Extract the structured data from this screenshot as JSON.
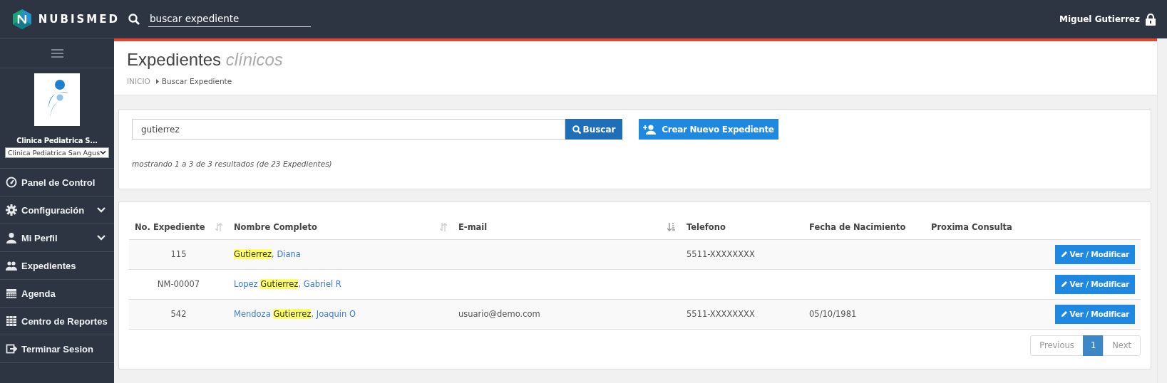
{
  "topbar": {
    "brand": "NUBISMED",
    "search": {
      "placeholder": "buscar expediente"
    },
    "user": "Miguel Gutierrez"
  },
  "sidebar": {
    "clinic_name": "Clinica Pediatrica S...",
    "clinic_select": "Clinica Pediatrica San Agus",
    "items": [
      {
        "label": "Panel de Control",
        "expandable": false
      },
      {
        "label": "Configuración",
        "expandable": true
      },
      {
        "label": "Mi Perfil",
        "expandable": true
      },
      {
        "label": "Expedientes",
        "expandable": false
      },
      {
        "label": "Agenda",
        "expandable": false
      },
      {
        "label": "Centro de Reportes",
        "expandable": false
      },
      {
        "label": "Terminar Sesion",
        "expandable": false
      }
    ]
  },
  "page": {
    "title": "Expedientes",
    "subtitle": "clínicos",
    "breadcrumb": [
      "INICIO",
      "Buscar Expediente"
    ]
  },
  "search_panel": {
    "value": "gutierrez",
    "search_button": "Buscar",
    "create_button": "Crear Nuevo Expediente",
    "summary": "mostrando 1 a 3 de 3 resultados (de 23 Expedientes)"
  },
  "table": {
    "columns": [
      {
        "label": "No. Expediente",
        "sortable": true,
        "sorted": false
      },
      {
        "label": "Nombre Completo",
        "sortable": true,
        "sorted": false
      },
      {
        "label": "E-mail",
        "sortable": true,
        "sorted": true
      },
      {
        "label": "Telefono",
        "sortable": false
      },
      {
        "label": "Fecha de Nacimiento",
        "sortable": false
      },
      {
        "label": "Proxima Consulta",
        "sortable": false
      }
    ],
    "rows": [
      {
        "number": "115",
        "name": [
          {
            "text": "Gutierrez",
            "highlight": true
          },
          {
            "text": ", Diana",
            "highlight": false
          }
        ],
        "phone": "5511-XXXXXXXX",
        "action": "Ver / Modificar"
      },
      {
        "number": "NM-00007",
        "name": [
          {
            "text": "Lopez ",
            "highlight": false
          },
          {
            "text": "Gutierrez",
            "highlight": true
          },
          {
            "text": ", Gabriel R",
            "highlight": false
          }
        ],
        "action": "Ver / Modificar"
      },
      {
        "number": "542",
        "name": [
          {
            "text": "Mendoza ",
            "highlight": false
          },
          {
            "text": "Gutierrez",
            "highlight": true
          },
          {
            "text": ", Joaquin O",
            "highlight": false
          }
        ],
        "email": "usuario@demo.com",
        "phone": "5511-XXXXXXXX",
        "birth": "05/10/1981",
        "action": "Ver / Modificar"
      }
    ]
  },
  "pagination": [
    {
      "label": "Previous",
      "selected": false,
      "disabled": true
    },
    {
      "label": "1",
      "selected": true,
      "disabled": false
    },
    {
      "label": "Next",
      "selected": false,
      "disabled": true
    }
  ]
}
